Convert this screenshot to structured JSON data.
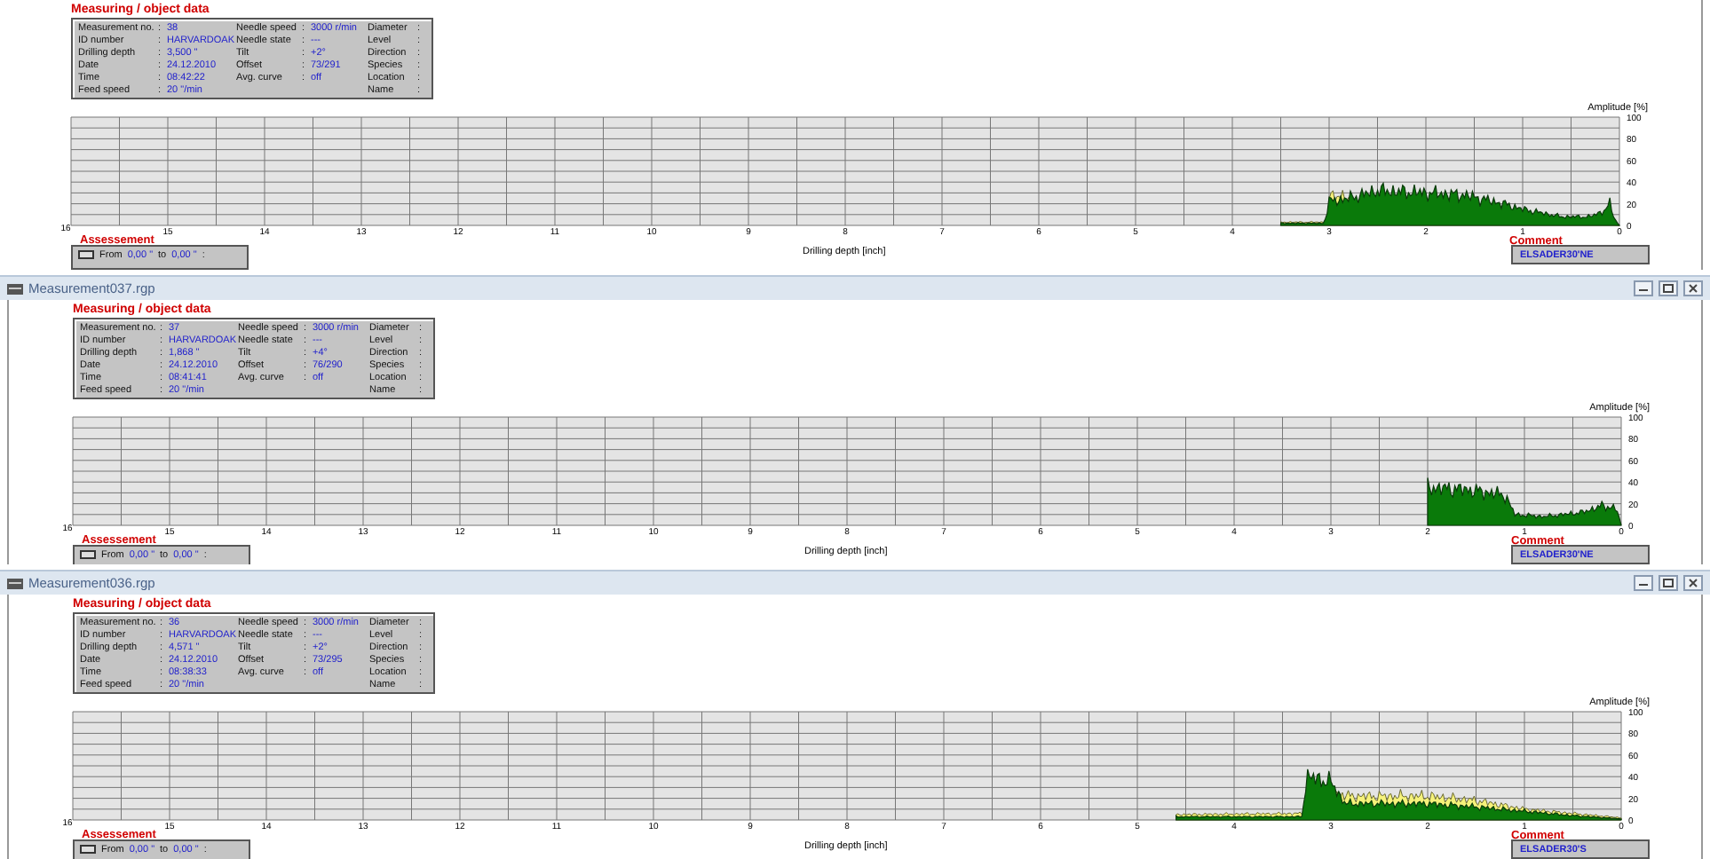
{
  "panels": [
    {
      "title": "Measuring / object data",
      "info": {
        "separator": ":",
        "columns": [
          [
            {
              "label": "Measurement no.",
              "value": "38"
            },
            {
              "label": "ID number",
              "value": "HARVARDOAK"
            },
            {
              "label": "Drilling depth",
              "value": "3,500 \""
            },
            {
              "label": "Date",
              "value": "24.12.2010"
            },
            {
              "label": "Time",
              "value": "08:42:22"
            },
            {
              "label": "Feed speed",
              "value": "20 \"/min"
            }
          ],
          [
            {
              "label": "Needle speed",
              "value": "3000 r/min"
            },
            {
              "label": "Needle state",
              "value": "---"
            },
            {
              "label": "Tilt",
              "value": "+2°"
            },
            {
              "label": "Offset",
              "value": "73/291"
            },
            {
              "label": "Avg. curve",
              "value": "off"
            }
          ],
          [
            {
              "label": "Diameter"
            },
            {
              "label": "Level"
            },
            {
              "label": "Direction"
            },
            {
              "label": "Species"
            },
            {
              "label": "Location"
            },
            {
              "label": "Name"
            }
          ]
        ]
      },
      "chart": {
        "y_title": "Amplitude [%]",
        "y_ticks": [
          "100",
          "80",
          "60",
          "40",
          "20",
          "0"
        ],
        "x_ticks": [
          "16",
          "15",
          "14",
          "13",
          "12",
          "11",
          "10",
          "9",
          "8",
          "7",
          "6",
          "5",
          "4",
          "3",
          "2",
          "1",
          "0"
        ],
        "x_title": "Drilling depth [inch]"
      },
      "assessment": {
        "label": "Assessement",
        "from_label": "From",
        "from": "0,00 \"",
        "to_label": "to",
        "to": "0,00 \"",
        "separator": ":"
      },
      "comment": {
        "label": "Comment",
        "text": "ELSADER30'NE"
      }
    },
    {
      "window_title": "Measurement037.rgp",
      "title": "Measuring / object data",
      "info": {
        "separator": ":",
        "columns": [
          [
            {
              "label": "Measurement no.",
              "value": "37"
            },
            {
              "label": "ID number",
              "value": "HARVARDOAK"
            },
            {
              "label": "Drilling depth",
              "value": "1,868 \""
            },
            {
              "label": "Date",
              "value": "24.12.2010"
            },
            {
              "label": "Time",
              "value": "08:41:41"
            },
            {
              "label": "Feed speed",
              "value": "20 \"/min"
            }
          ],
          [
            {
              "label": "Needle speed",
              "value": "3000 r/min"
            },
            {
              "label": "Needle state",
              "value": "---"
            },
            {
              "label": "Tilt",
              "value": "+4°"
            },
            {
              "label": "Offset",
              "value": "76/290"
            },
            {
              "label": "Avg. curve",
              "value": "off"
            }
          ],
          [
            {
              "label": "Diameter"
            },
            {
              "label": "Level"
            },
            {
              "label": "Direction"
            },
            {
              "label": "Species"
            },
            {
              "label": "Location"
            },
            {
              "label": "Name"
            }
          ]
        ]
      },
      "chart": {
        "y_title": "Amplitude [%]",
        "y_ticks": [
          "100",
          "80",
          "60",
          "40",
          "20",
          "0"
        ],
        "x_ticks": [
          "16",
          "15",
          "14",
          "13",
          "12",
          "11",
          "10",
          "9",
          "8",
          "7",
          "6",
          "5",
          "4",
          "3",
          "2",
          "1",
          "0"
        ],
        "x_title": "Drilling depth [inch]"
      },
      "assessment": {
        "label": "Assessement",
        "from_label": "From",
        "from": "0,00 \"",
        "to_label": "to",
        "to": "0,00 \"",
        "separator": ":"
      },
      "comment": {
        "label": "Comment",
        "text": "ELSADER30'NE"
      }
    },
    {
      "window_title": "Measurement036.rgp",
      "title": "Measuring / object data",
      "info": {
        "separator": ":",
        "columns": [
          [
            {
              "label": "Measurement no.",
              "value": "36"
            },
            {
              "label": "ID number",
              "value": "HARVARDOAK"
            },
            {
              "label": "Drilling depth",
              "value": "4,571 \""
            },
            {
              "label": "Date",
              "value": "24.12.2010"
            },
            {
              "label": "Time",
              "value": "08:38:33"
            },
            {
              "label": "Feed speed",
              "value": "20 \"/min"
            }
          ],
          [
            {
              "label": "Needle speed",
              "value": "3000 r/min"
            },
            {
              "label": "Needle state",
              "value": "---"
            },
            {
              "label": "Tilt",
              "value": "+2°"
            },
            {
              "label": "Offset",
              "value": "73/295"
            },
            {
              "label": "Avg. curve",
              "value": "off"
            }
          ],
          [
            {
              "label": "Diameter"
            },
            {
              "label": "Level"
            },
            {
              "label": "Direction"
            },
            {
              "label": "Species"
            },
            {
              "label": "Location"
            },
            {
              "label": "Name"
            }
          ]
        ]
      },
      "chart": {
        "y_title": "Amplitude [%]",
        "y_ticks": [
          "100",
          "80",
          "60",
          "40",
          "20",
          "0"
        ],
        "x_ticks": [
          "16",
          "15",
          "14",
          "13",
          "12",
          "11",
          "10",
          "9",
          "8",
          "7",
          "6",
          "5",
          "4",
          "3",
          "2",
          "1",
          "0"
        ],
        "x_title": "Drilling depth [inch]"
      },
      "assessment": {
        "label": "Assessement",
        "from_label": "From",
        "from": "0,00 \"",
        "to_label": "to",
        "to": "0,00 \"",
        "separator": ":"
      },
      "comment": {
        "label": "Comment",
        "text": "ELSADER30'S"
      }
    }
  ]
}
